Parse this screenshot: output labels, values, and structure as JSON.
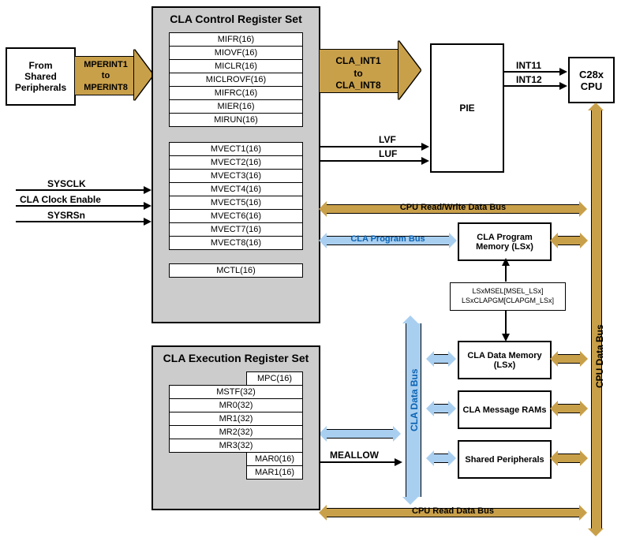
{
  "peripherals_block": {
    "line1": "From",
    "line2": "Shared",
    "line3": "Peripherals"
  },
  "mperint_arrow": {
    "line1": "MPERINT1",
    "line2": "to",
    "line3": "MPERINT8"
  },
  "claint_arrow": {
    "line1": "CLA_INT1",
    "line2": "to",
    "line3": "CLA_INT8"
  },
  "pie_box": "PIE",
  "cpu_box": {
    "line1": "C28x",
    "line2": "CPU"
  },
  "pie_to_cpu": {
    "sig1": "INT11",
    "sig2": "INT12"
  },
  "lvf_luf": {
    "sig1": "LVF",
    "sig2": "LUF"
  },
  "left_signals": {
    "s1": "SYSCLK",
    "s2": "CLA Clock Enable",
    "s3": "SYSRSn"
  },
  "mealow": "MEALLOW",
  "ctrl_set": {
    "title": "CLA Control Register Set",
    "group1": [
      "MIFR(16)",
      "MIOVF(16)",
      "MICLR(16)",
      "MICLROVF(16)",
      "MIFRC(16)",
      "MIER(16)",
      "MIRUN(16)"
    ],
    "group2": [
      "MVECT1(16)",
      "MVECT2(16)",
      "MVECT3(16)",
      "MVECT4(16)",
      "MVECT5(16)",
      "MVECT6(16)",
      "MVECT7(16)",
      "MVECT8(16)"
    ],
    "single": "MCTL(16)"
  },
  "exec_set": {
    "title": "CLA Execution Register Set",
    "top": "MPC(16)",
    "wide": [
      "MSTF(32)",
      "MR0(32)",
      "MR1(32)",
      "MR2(32)",
      "MR3(32)"
    ],
    "bottom": [
      "MAR0(16)",
      "MAR1(16)"
    ]
  },
  "buses": {
    "cpu_rw": "CPU Read/Write Data Bus",
    "cla_prog": "CLA Program Bus",
    "cla_data": "CLA Data Bus",
    "cpu_data": "CPU Data Bus",
    "cpu_read": "CPU Read Data Bus"
  },
  "mem_blocks": {
    "prog": "CLA Program Memory (LSx)",
    "cfg": [
      "LSxMSEL[MSEL_LSx]",
      "LSxCLAPGM[CLAPGM_LSx]"
    ],
    "data_mem": "CLA Data Memory (LSx)",
    "msg": "CLA Message RAMs",
    "shared": "Shared Peripherals"
  }
}
